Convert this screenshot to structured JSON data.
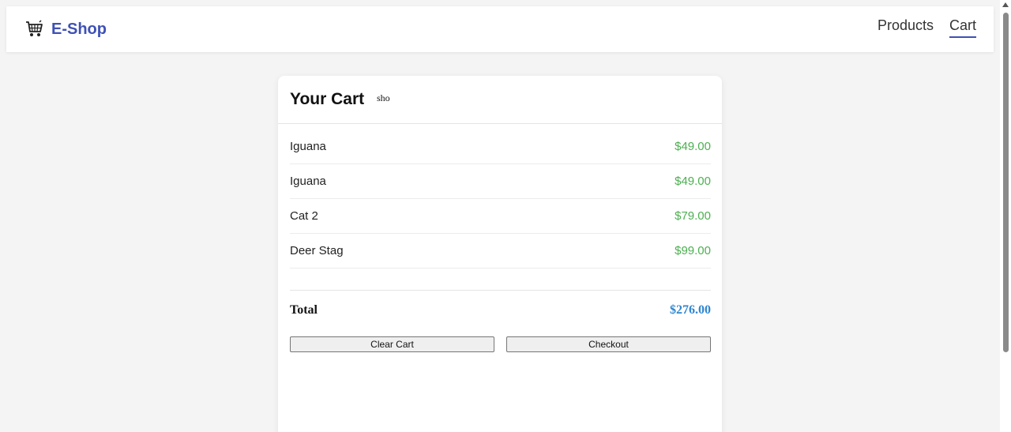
{
  "header": {
    "brand": "E-Shop",
    "brand_icon": "shopping-cart-icon",
    "nav": [
      {
        "label": "Products",
        "active": false
      },
      {
        "label": "Cart",
        "active": true
      }
    ]
  },
  "cart": {
    "title": "Your Cart",
    "title_image_alt": "sho",
    "items": [
      {
        "name": "Iguana",
        "price": "$49.00"
      },
      {
        "name": "Iguana",
        "price": "$49.00"
      },
      {
        "name": "Cat 2",
        "price": "$79.00"
      },
      {
        "name": "Deer Stag",
        "price": "$99.00"
      }
    ],
    "total_label": "Total",
    "total_value": "$276.00",
    "clear_label": "Clear Cart",
    "checkout_label": "Checkout"
  },
  "colors": {
    "brand": "#3f51b5",
    "price": "#4caf50",
    "total": "#2f86d0",
    "background": "#f4f4f4"
  }
}
